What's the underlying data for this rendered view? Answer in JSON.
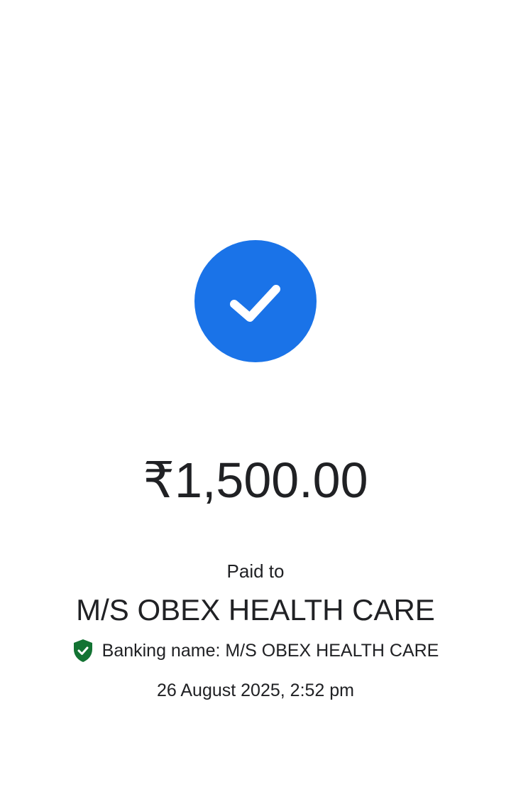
{
  "status": {
    "icon": "check-icon",
    "color": "#1a73e8"
  },
  "amount": "₹1,500.00",
  "paid_to_label": "Paid to",
  "payee_name": "M/S OBEX HEALTH CARE",
  "banking": {
    "icon": "verified-shield-icon",
    "icon_color": "#137333",
    "text": "Banking name: M/S OBEX HEALTH CARE"
  },
  "datetime": "26 August 2025, 2:52 pm"
}
